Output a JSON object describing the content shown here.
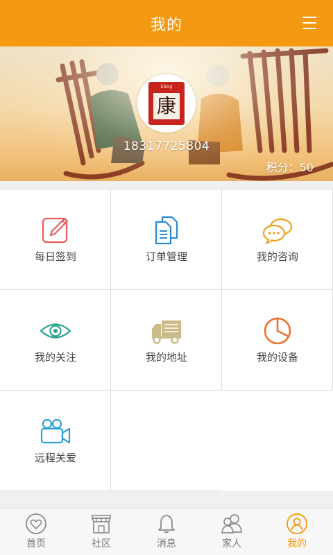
{
  "header": {
    "title": "我的",
    "menu_icon": "menu-icon"
  },
  "profile": {
    "avatar_char": "康",
    "avatar_pinyin": "kāng",
    "phone": "18317725804",
    "points_text": "积分：50"
  },
  "grid": [
    {
      "label": "每日签到",
      "icon": "edit-icon",
      "color": "#e95b5b"
    },
    {
      "label": "订单管理",
      "icon": "documents-icon",
      "color": "#2b8ad6"
    },
    {
      "label": "我的咨询",
      "icon": "chat-bubbles-icon",
      "color": "#f0a020"
    },
    {
      "label": "我的关注",
      "icon": "eye-icon",
      "color": "#2aa38f"
    },
    {
      "label": "我的地址",
      "icon": "truck-icon",
      "color": "#c9bb8a"
    },
    {
      "label": "我的设备",
      "icon": "pie-chart-icon",
      "color": "#ee6e2b"
    },
    {
      "label": "远程关爱",
      "icon": "video-camera-icon",
      "color": "#2aa0d8"
    }
  ],
  "tabs": [
    {
      "label": "首页",
      "icon": "heart-circle-icon"
    },
    {
      "label": "社区",
      "icon": "store-icon"
    },
    {
      "label": "消息",
      "icon": "bell-icon"
    },
    {
      "label": "家人",
      "icon": "family-icon"
    },
    {
      "label": "我的",
      "icon": "user-circle-icon",
      "active": true
    }
  ],
  "colors": {
    "accent": "#f39a12",
    "inactive": "#7a7a7a"
  }
}
